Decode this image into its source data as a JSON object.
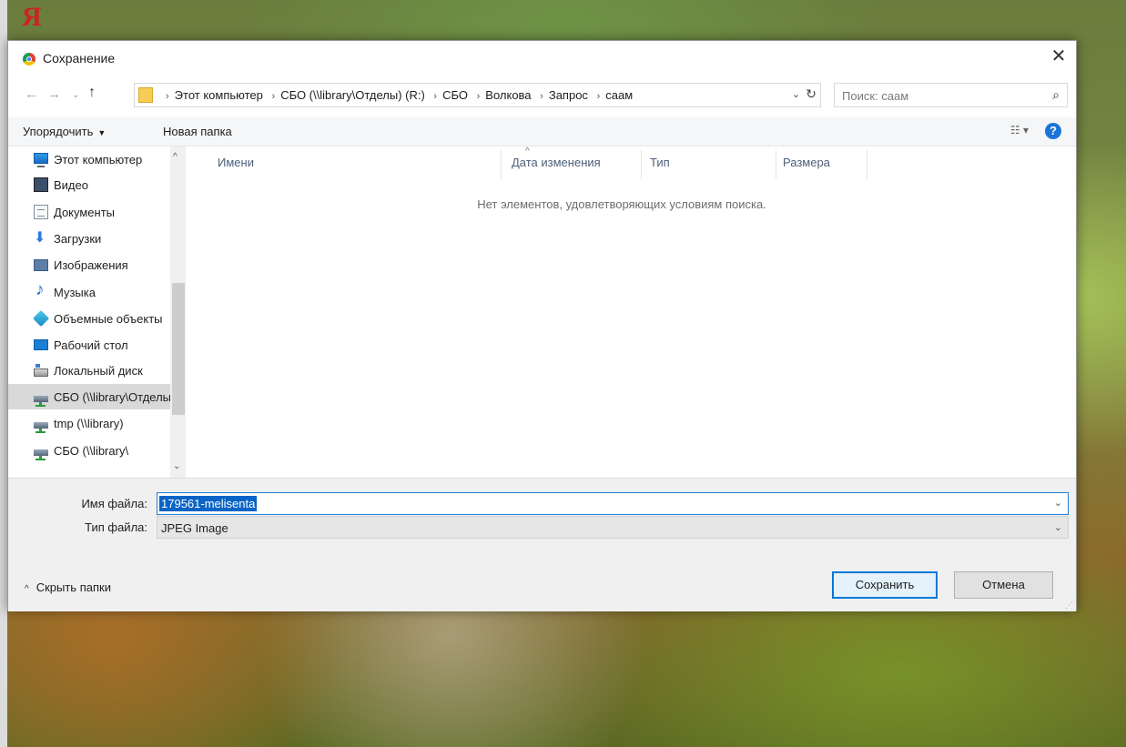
{
  "background": {
    "browser_logo": "Я"
  },
  "dialog": {
    "title": "Сохранение",
    "close_label": "✕",
    "address": {
      "crumbs": [
        "Этот компьютер",
        "СБО (\\\\library\\Отделы) (R:)",
        "СБО",
        "Волкова",
        "Запрос",
        "саам"
      ]
    },
    "search": {
      "placeholder": "Поиск: саам"
    },
    "toolbar": {
      "organize_label": "Упорядочить",
      "new_folder_label": "Новая папка",
      "help_label": "?"
    },
    "nav_pane": {
      "items": [
        {
          "label": "Этот компьютер",
          "icon": "computer-icon"
        },
        {
          "label": "Видео",
          "icon": "video-icon"
        },
        {
          "label": "Документы",
          "icon": "documents-icon"
        },
        {
          "label": "Загрузки",
          "icon": "downloads-icon"
        },
        {
          "label": "Изображения",
          "icon": "pictures-icon"
        },
        {
          "label": "Музыка",
          "icon": "music-icon"
        },
        {
          "label": "Объемные объекты",
          "icon": "3d-objects-icon"
        },
        {
          "label": "Рабочий стол",
          "icon": "desktop-icon"
        },
        {
          "label": "Локальный диск",
          "icon": "local-disk-icon"
        },
        {
          "label": "СБО (\\\\library\\Отделы)",
          "icon": "network-drive-icon",
          "selected": true
        },
        {
          "label": "tmp (\\\\library)",
          "icon": "network-drive-icon"
        },
        {
          "label": "СБО (\\\\library\\",
          "icon": "network-drive-icon"
        }
      ]
    },
    "columns": [
      "Имени",
      "Дата изменения",
      "Тип",
      "Размера"
    ],
    "empty_message": "Нет элементов, удовлетворяющих условиям поиска.",
    "file_name": {
      "label": "Имя файла:",
      "value": "179561-melisenta"
    },
    "file_type": {
      "label": "Тип файла:",
      "value": "JPEG Image"
    },
    "hide_folders_label": "Скрыть папки",
    "save_label": "Сохранить",
    "cancel_label": "Отмена"
  }
}
